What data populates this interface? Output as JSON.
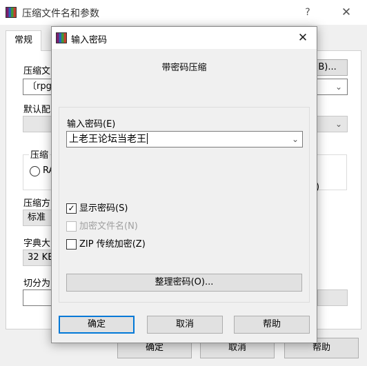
{
  "background_window": {
    "title": "压缩文件名和参数",
    "help_glyph": "?",
    "close_glyph": "✕",
    "tab_general": "常规",
    "archive_name_label": "压缩文",
    "browse_button": "(B)...",
    "archive_name_value": "〔rpg",
    "default_profile_label": "默认配",
    "compress_group_label": "压缩",
    "radio_label": "RA",
    "method_label": "压缩方",
    "method_value": "标准",
    "dict_label": "字典大",
    "dict_value": "32 KB",
    "split_label": "切分为",
    "right_paren": ")",
    "ok_button": "确定",
    "cancel_button": "取消",
    "help_button": "帮助"
  },
  "dialog": {
    "title": "输入密码",
    "close_glyph": "✕",
    "heading": "带密码压缩",
    "password_label": "输入密码(E)",
    "password_value": "上老王论坛当老王",
    "show_password_label": "显示密码(S)",
    "show_password_checked": true,
    "encrypt_filenames_label": "加密文件名(N)",
    "encrypt_filenames_checked": false,
    "encrypt_filenames_disabled": true,
    "zip_legacy_label": "ZIP 传统加密(Z)",
    "zip_legacy_checked": false,
    "organize_button": "整理密码(O)...",
    "ok_button": "确定",
    "cancel_button": "取消",
    "help_button": "帮助"
  },
  "icons": {
    "chevron_down": "⌄",
    "checkmark": "✓"
  },
  "colors": {
    "default_button_border": "#0078d7",
    "window_bg": "#f0f0f0",
    "disabled_text": "#a0a0a0"
  }
}
